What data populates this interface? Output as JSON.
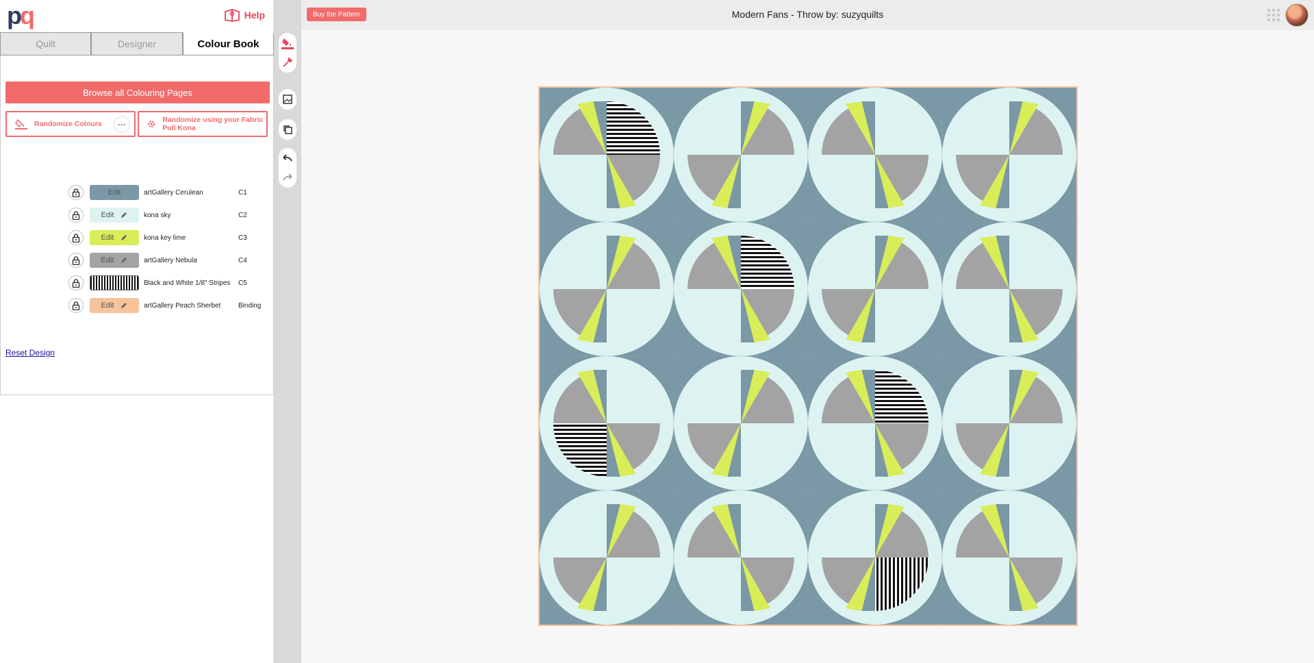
{
  "logo": {
    "p": "p",
    "q": "q"
  },
  "help_label": "Help",
  "tabs": [
    {
      "label": "Quilt",
      "active": false
    },
    {
      "label": "Designer",
      "active": false
    },
    {
      "label": "Colour Book",
      "active": true
    }
  ],
  "browse_label": "Browse all Colouring Pages",
  "randomize_colours_label": "Randomize Colours",
  "randomize_fabric_label": "Randomize using your Fabric Pull Kona",
  "more_label": "···",
  "edit_label": "Edit",
  "colors": [
    {
      "name": "artGallery Cerulean",
      "code": "C1",
      "hex": "#7a98a5",
      "editable_icon": false
    },
    {
      "name": "kona sky",
      "code": "C2",
      "hex": "#ddf3f2",
      "editable_icon": true
    },
    {
      "name": "kona key lime",
      "code": "C3",
      "hex": "#d9ed58",
      "editable_icon": true
    },
    {
      "name": "artGallery Nebula",
      "code": "C4",
      "hex": "#a3a3a3",
      "editable_icon": true
    },
    {
      "name": "Black and White 1/8\" Stripes",
      "code": "C5",
      "hex": "stripes",
      "editable_icon": false
    },
    {
      "name": "artGallery Peach Sherbet",
      "code": "Binding",
      "hex": "#f7c39b",
      "editable_icon": true
    }
  ],
  "reset_label": "Reset Design",
  "buy_label": "Buy the Pattern",
  "pattern_title": "Modern Fans - Throw  by: suzyquilts",
  "accent": "#f26b6b",
  "quilt": {
    "rows": 4,
    "cols": 4,
    "colors": {
      "background": "#7a98a5",
      "circle": "#ddf3f2",
      "lime": "#d9ed58",
      "grey": "#a3a3a3",
      "blue": "#7a98a5"
    }
  }
}
